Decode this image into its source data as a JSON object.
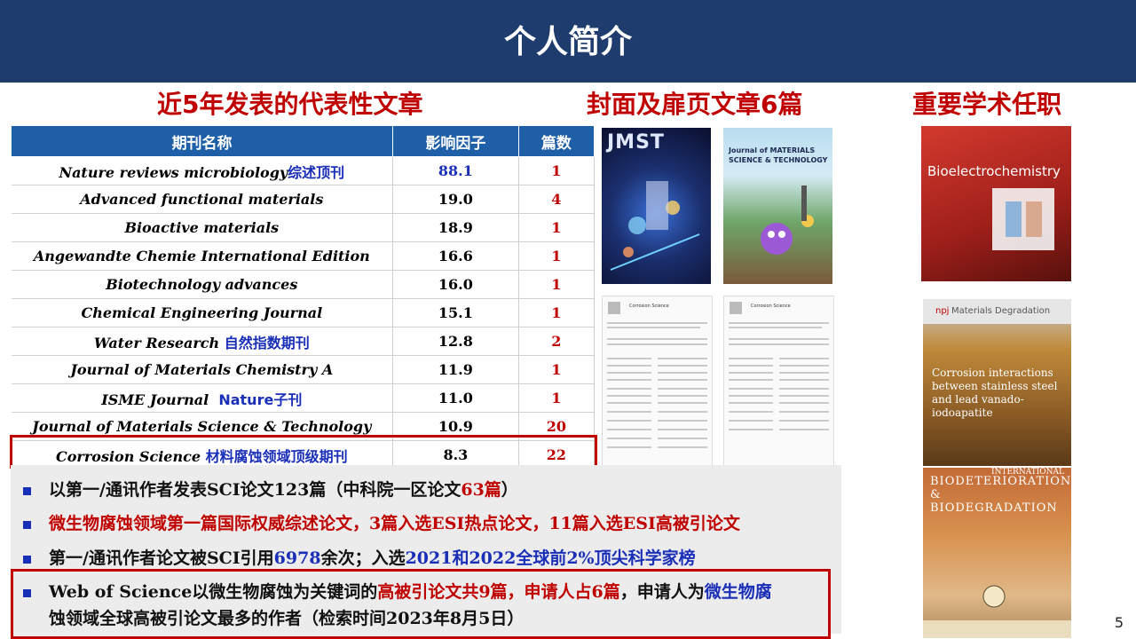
{
  "header": {
    "title": "个人简介"
  },
  "sections": {
    "articles": "近5年发表的代表性文章",
    "covers": "封面及扉页文章6篇",
    "roles": "重要学术任职"
  },
  "table": {
    "headers": [
      "期刊名称",
      "影响因子",
      "篇数"
    ],
    "rows": [
      {
        "name": "Nature reviews microbiology",
        "note": "综述顶刊",
        "if": "88.1",
        "count": "1"
      },
      {
        "name": "Advanced functional materials",
        "note": "",
        "if": "19.0",
        "count": "4"
      },
      {
        "name": "Bioactive materials",
        "note": "",
        "if": "18.9",
        "count": "1"
      },
      {
        "name": "Angewandte Chemie International Edition",
        "note": "",
        "if": "16.6",
        "count": "1"
      },
      {
        "name": "Biotechnology advances",
        "note": "",
        "if": "16.0",
        "count": "1"
      },
      {
        "name": "Chemical Engineering Journal",
        "note": "",
        "if": "15.1",
        "count": "1"
      },
      {
        "name": "Water Research",
        "note": "自然指数期刊",
        "if": "12.8",
        "count": "2"
      },
      {
        "name": "Journal of Materials Chemistry A",
        "note": "",
        "if": "11.9",
        "count": "1"
      },
      {
        "name": "ISME Journal",
        "note": "Nature子刊",
        "if": "11.0",
        "count": "1"
      },
      {
        "name": "Journal of Materials Science & Technology",
        "note": "",
        "if": "10.9",
        "count": "20"
      },
      {
        "name": "Corrosion Science",
        "note": "材料腐蚀领域顶级期刊",
        "if": "8.3",
        "count": "22"
      }
    ]
  },
  "covers": {
    "jmst": "JMST",
    "jmst2": "Journal of MATERIALS SCIENCE & TECHNOLOGY",
    "paper1": "Corrosion Science",
    "paper2": "Corrosion Science"
  },
  "roles": {
    "bioelectro": "Bioelectrochemistry",
    "npj": "Materials Degradation",
    "npj_logo": "npj",
    "npj_article": "Corrosion interactions between stainless steel and lead vanado-iodoapatite",
    "ibb1": "INTERNATIONAL",
    "ibb2": "BIODETERIORATION & BIODEGRADATION"
  },
  "bullets": {
    "b1": {
      "a": "以第一/通讯作者发表SCI论文123篇（中科院一区论文",
      "b": "63篇",
      "c": "）"
    },
    "b2": {
      "a": "微生物腐蚀领域第一篇国际权威综述论文，3篇入选ESI热点论文，11篇入选ESI高被引论文"
    },
    "b3": {
      "a": "第一/通讯作者论文被SCI引用",
      "b": "6978",
      "c": "余次；入选",
      "d": "2021和2022全球前2%顶尖科学家榜"
    },
    "b4": {
      "a": "Web of Science以微生物腐蚀为关键词的",
      "b": "高被引论文共9篇，申请人占6篇",
      "c": "，申请人为",
      "d": "微生物腐",
      "e": "蚀领域全球高被引论文最多的作者（检索时间2023年8月5日）"
    }
  },
  "page_number": "5",
  "colors": {
    "header": "#1f3c6e",
    "accent_red": "#c00000",
    "table_head": "#1f5fa8",
    "accent_blue": "#1a2fb8"
  }
}
